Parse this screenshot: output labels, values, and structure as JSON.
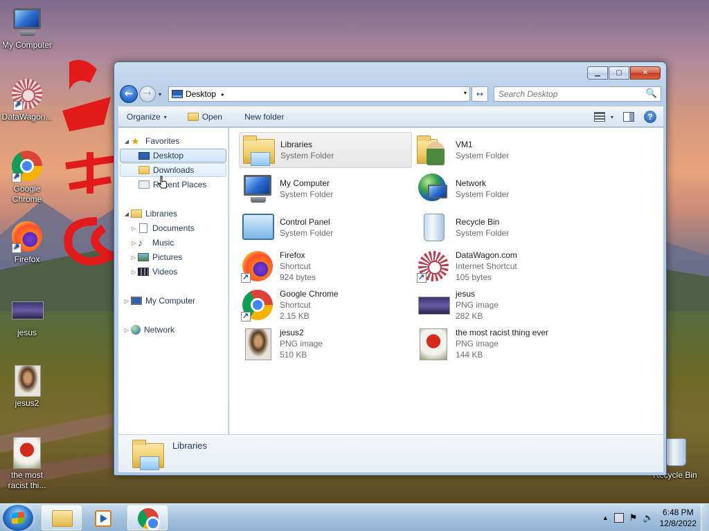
{
  "desktop": {
    "icons": [
      {
        "label": "My Computer",
        "icon": "my-computer-icon"
      },
      {
        "label": "DataWagon...",
        "icon": "datawagon-icon"
      },
      {
        "label": "Google Chrome",
        "icon": "chrome-icon"
      },
      {
        "label": "Firefox",
        "icon": "firefox-icon"
      },
      {
        "label": "jesus",
        "icon": "image-thumbnail-icon"
      },
      {
        "label": "jesus2",
        "icon": "image-thumbnail-icon"
      },
      {
        "label": "the most racist thi...",
        "icon": "image-thumbnail-icon"
      },
      {
        "label": "Recycle Bin",
        "icon": "recycle-bin-icon"
      }
    ]
  },
  "window": {
    "controls": {
      "minimize": "▁",
      "maximize": "▢",
      "close": "✕"
    },
    "address": {
      "crumb": "Desktop",
      "separator": "▸",
      "dropdown": "▾"
    },
    "refresh": "↔",
    "search": {
      "placeholder": "Search Desktop",
      "icon": "🔍"
    },
    "toolbar": {
      "organize": "Organize",
      "open": "Open",
      "new_folder": "New folder",
      "arrow": "▾",
      "help": "?"
    },
    "nav": {
      "favorites": "Favorites",
      "desktop": "Desktop",
      "downloads": "Downloads",
      "recent": "Recent Places",
      "libraries": "Libraries",
      "documents": "Documents",
      "music": "Music",
      "pictures": "Pictures",
      "videos": "Videos",
      "my_computer": "My Computer",
      "network": "Network",
      "expanded": "◢",
      "collapsed": "▷"
    },
    "items": [
      {
        "name": "Libraries",
        "line2": "System Folder",
        "line3": ""
      },
      {
        "name": "VM1",
        "line2": "System Folder",
        "line3": ""
      },
      {
        "name": "My Computer",
        "line2": "System Folder",
        "line3": ""
      },
      {
        "name": "Network",
        "line2": "System Folder",
        "line3": ""
      },
      {
        "name": "Control Panel",
        "line2": "System Folder",
        "line3": ""
      },
      {
        "name": "Recycle Bin",
        "line2": "System Folder",
        "line3": ""
      },
      {
        "name": "Firefox",
        "line2": "Shortcut",
        "line3": "924 bytes"
      },
      {
        "name": "DataWagon.com",
        "line2": "Internet Shortcut",
        "line3": "105 bytes"
      },
      {
        "name": "Google Chrome",
        "line2": "Shortcut",
        "line3": "2.15 KB"
      },
      {
        "name": "jesus",
        "line2": "PNG image",
        "line3": "282 KB"
      },
      {
        "name": "jesus2",
        "line2": "PNG image",
        "line3": "510 KB"
      },
      {
        "name": "the most racist thing ever",
        "line2": "PNG image",
        "line3": "144 KB"
      }
    ],
    "details": {
      "name": "Libraries"
    }
  },
  "taskbar": {
    "tray_arrow": "▲",
    "time": "6:48 PM",
    "date": "12/8/2022"
  }
}
